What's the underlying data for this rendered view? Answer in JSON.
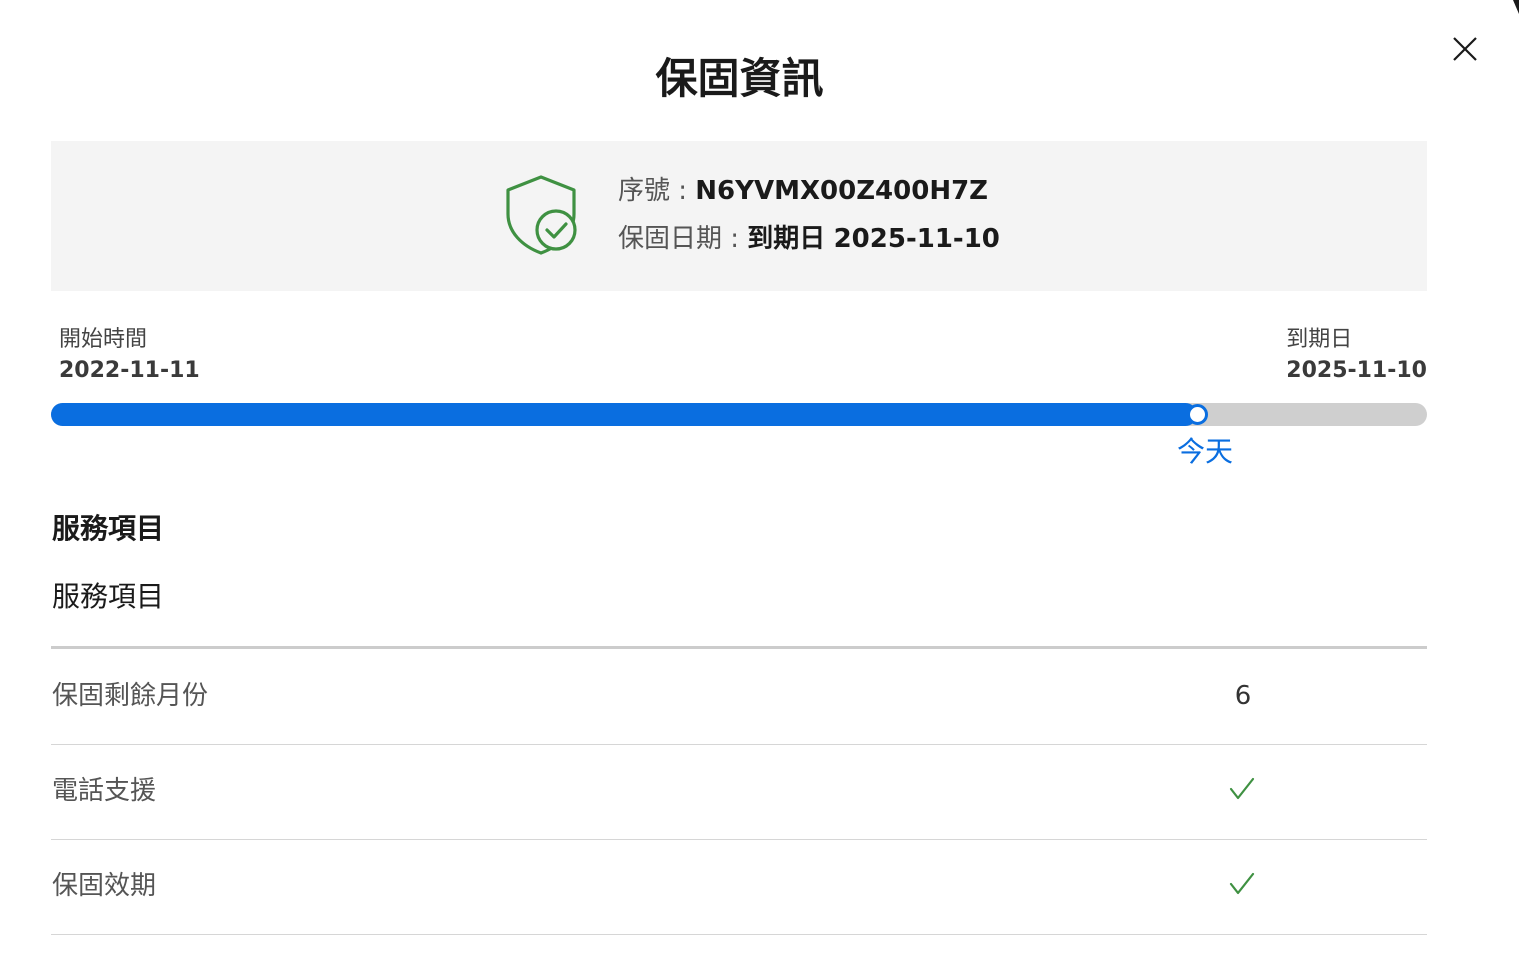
{
  "title": "保固資訊",
  "close_icon": "close-icon",
  "product": {
    "shield_icon": "shield-check-icon",
    "serial_label": "序號 : ",
    "serial_value": "N6YVMX00Z400H7Z",
    "warranty_label": "保固日期 : ",
    "warranty_status": "到期日",
    "warranty_date": "2025-11-10",
    "shield_color": "#3f9142"
  },
  "timeline": {
    "start_label": "開始時間",
    "start_date": "2022-11-11",
    "end_label": "到期日",
    "end_date": "2025-11-10",
    "today_label": "今天",
    "progress_fraction": 0.833,
    "fill_color": "#0a6ee0",
    "track_color": "#cfcfcf"
  },
  "services": {
    "heading": "服務項目",
    "column_header": "服務項目",
    "rows": [
      {
        "label": "保固剩餘月份",
        "value": "6",
        "type": "text"
      },
      {
        "label": "電話支援",
        "value": "",
        "type": "check"
      },
      {
        "label": "保固效期",
        "value": "",
        "type": "check"
      }
    ],
    "check_color": "#3f9142"
  }
}
